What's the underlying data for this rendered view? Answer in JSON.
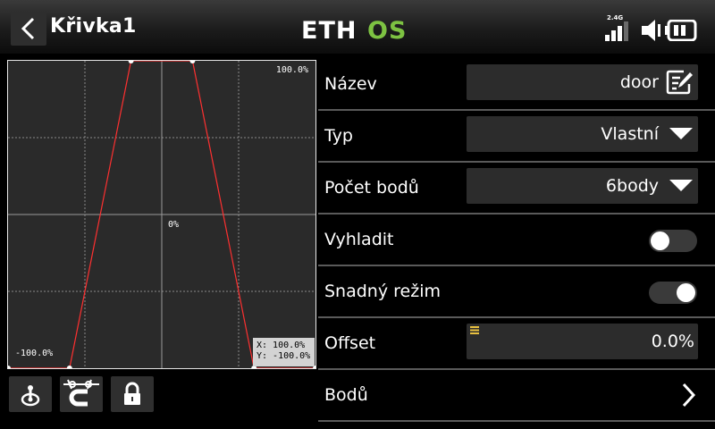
{
  "header": {
    "title": "Křivka1",
    "logo": "ETHOS",
    "rf_label": "2.4G",
    "icons": [
      "back-arrow-icon",
      "signal-bars-icon",
      "speaker-muted-icon",
      "battery-icon"
    ]
  },
  "graph": {
    "top_label": "100.0%",
    "center_label": "0%",
    "bottom_label": "-100.0%",
    "coord_x": "X: 100.0%",
    "coord_y": "Y: -100.0%",
    "curve_points": [
      {
        "x": -100,
        "y": -100
      },
      {
        "x": -60,
        "y": -100
      },
      {
        "x": -20,
        "y": 100
      },
      {
        "x": 20,
        "y": 100
      },
      {
        "x": 60,
        "y": -100
      },
      {
        "x": 100,
        "y": -100
      }
    ],
    "xlim": [
      -100,
      100
    ],
    "ylim": [
      -100,
      100
    ],
    "curve_color": "#ff3030"
  },
  "toolbar": {
    "icons": [
      "trim-stick-icon",
      "magnet-snap-icon",
      "lock-icon"
    ]
  },
  "form": {
    "name_label": "Název",
    "name_value": "door",
    "type_label": "Typ",
    "type_value": "Vlastní",
    "points_label": "Počet bodů",
    "points_value": "6body",
    "smooth_label": "Vyhladit",
    "smooth_on": false,
    "easy_label": "Snadný režim",
    "easy_on": true,
    "offset_label": "Offset",
    "offset_value": "0.0%",
    "points_list_label": "Bodů"
  },
  "colors": {
    "accent_green": "#7dc242",
    "curve_red": "#ff3030"
  }
}
